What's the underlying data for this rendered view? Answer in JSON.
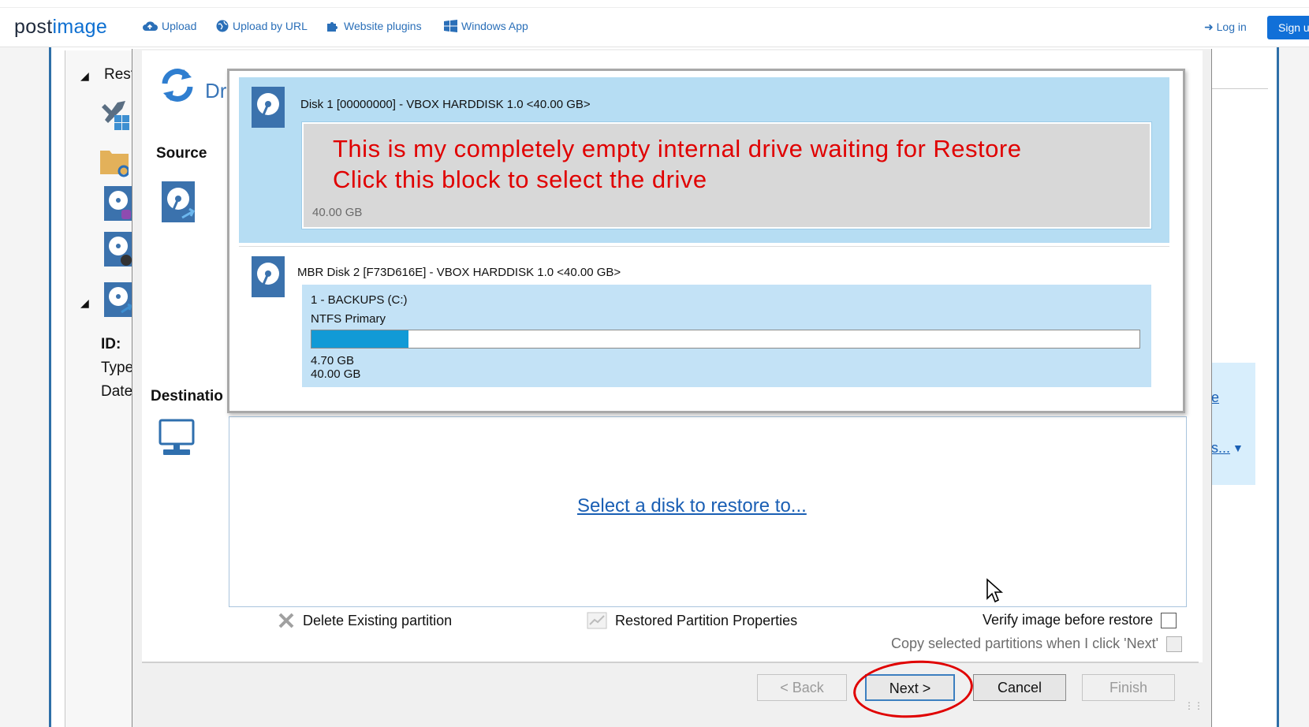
{
  "site": {
    "logo_first": "post",
    "logo_second": "image",
    "nav": [
      {
        "label": "Upload",
        "icon": "cloud-upload-icon"
      },
      {
        "label": "Upload by URL",
        "icon": "globe-icon"
      },
      {
        "label": "Website plugins",
        "icon": "puzzle-icon"
      },
      {
        "label": "Windows App",
        "icon": "windows-icon"
      }
    ],
    "login": "Log in",
    "signup": "Sign u",
    "accent": "#1170d8"
  },
  "background_app": {
    "tree_root": "Rest",
    "id_label": "ID:",
    "type_label": "Type",
    "date_label": "Date",
    "right_link_1": "e",
    "right_link_2": "s..."
  },
  "wizard": {
    "title_fragment": "Dr",
    "source_label": "Source",
    "destination_label": "Destinatio",
    "select_link": "Select a disk to restore to...",
    "options": {
      "delete_partition": "Delete Existing partition",
      "restored_props": "Restored Partition Properties",
      "verify": "Verify image before restore",
      "copy_selected": "Copy selected partitions when I click 'Next'"
    },
    "buttons": {
      "back": "< Back",
      "next": "Next >",
      "cancel": "Cancel",
      "finish": "Finish"
    },
    "annotation_color": "#e00000"
  },
  "disks": [
    {
      "title": "Disk 1 [00000000] - VBOX HARDDISK 1.0  <40.00 GB>",
      "note_line1": "This is my completely empty internal drive waiting for Restore",
      "note_line2": "Click this block to select the drive",
      "size": "40.00 GB",
      "selected": true,
      "color": "#b6ddf3"
    },
    {
      "title": "MBR Disk 2 [F73D616E] - VBOX HARDDISK 1.0  <40.00 GB>",
      "partition_name": "1 - BACKUPS (C:)",
      "partition_type": "NTFS Primary",
      "used": "4.70 GB",
      "total": "40.00 GB",
      "used_fraction": 0.1175,
      "bar_color": "#119ad6"
    }
  ]
}
